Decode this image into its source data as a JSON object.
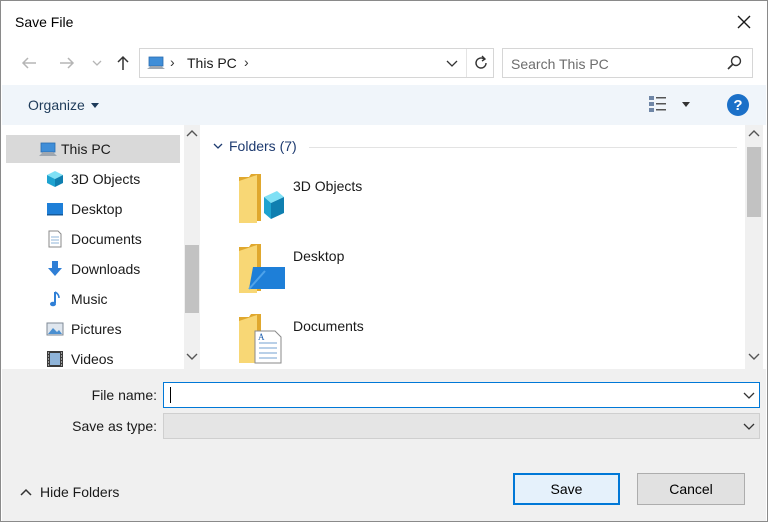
{
  "window": {
    "title": "Save File"
  },
  "nav": {
    "back_icon": "back-arrow-icon",
    "forward_icon": "forward-arrow-icon",
    "up_icon": "up-arrow-icon",
    "address_crumb": "This PC",
    "search_placeholder": "Search This PC"
  },
  "toolbar": {
    "organize_label": "Organize",
    "help_label": "?"
  },
  "sidebar": {
    "items": [
      {
        "label": "This PC",
        "icon": "computer-icon",
        "selected": true
      },
      {
        "label": "3D Objects",
        "icon": "3d-objects-icon"
      },
      {
        "label": "Desktop",
        "icon": "desktop-icon"
      },
      {
        "label": "Documents",
        "icon": "documents-icon"
      },
      {
        "label": "Downloads",
        "icon": "downloads-icon"
      },
      {
        "label": "Music",
        "icon": "music-icon"
      },
      {
        "label": "Pictures",
        "icon": "pictures-icon"
      },
      {
        "label": "Videos",
        "icon": "videos-icon"
      }
    ]
  },
  "main": {
    "group_header": "Folders (7)",
    "folders": [
      {
        "name": "3D Objects",
        "icon": "folder-3d-objects-icon"
      },
      {
        "name": "Desktop",
        "icon": "folder-desktop-icon"
      },
      {
        "name": "Documents",
        "icon": "folder-documents-icon"
      }
    ]
  },
  "form": {
    "file_name_label": "File name:",
    "file_name_value": "",
    "save_type_label": "Save as type:",
    "save_type_value": "",
    "hide_folders_label": "Hide Folders",
    "save_label": "Save",
    "cancel_label": "Cancel"
  },
  "colors": {
    "accent": "#0078d7",
    "toolbar_bg": "#f0f5fa",
    "selected_bg": "#d9d9d9",
    "help_bg": "#1b70c8"
  }
}
